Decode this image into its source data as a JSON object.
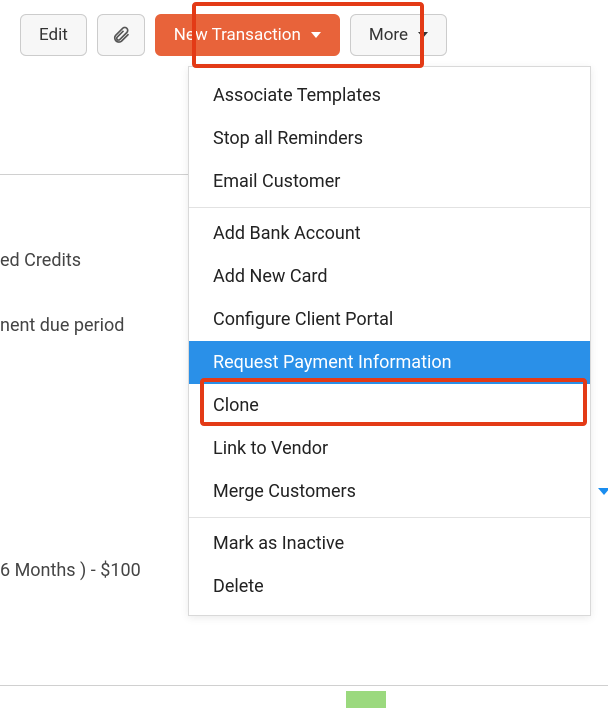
{
  "toolbar": {
    "edit_label": "Edit",
    "attach_icon": "paperclip",
    "new_transaction_label": "New Transaction",
    "more_label": "More"
  },
  "background": {
    "line1": "ed Credits",
    "line2": "nent due period",
    "line3": "6 Months ) - $100"
  },
  "menu": {
    "group1": [
      "Associate Templates",
      "Stop all Reminders",
      "Email Customer"
    ],
    "group2": [
      "Add Bank Account",
      "Add New Card",
      "Configure Client Portal",
      "Request Payment Information",
      "Clone",
      "Link to Vendor",
      "Merge Customers"
    ],
    "group3": [
      "Mark as Inactive",
      "Delete"
    ],
    "highlighted": "Request Payment Information"
  }
}
